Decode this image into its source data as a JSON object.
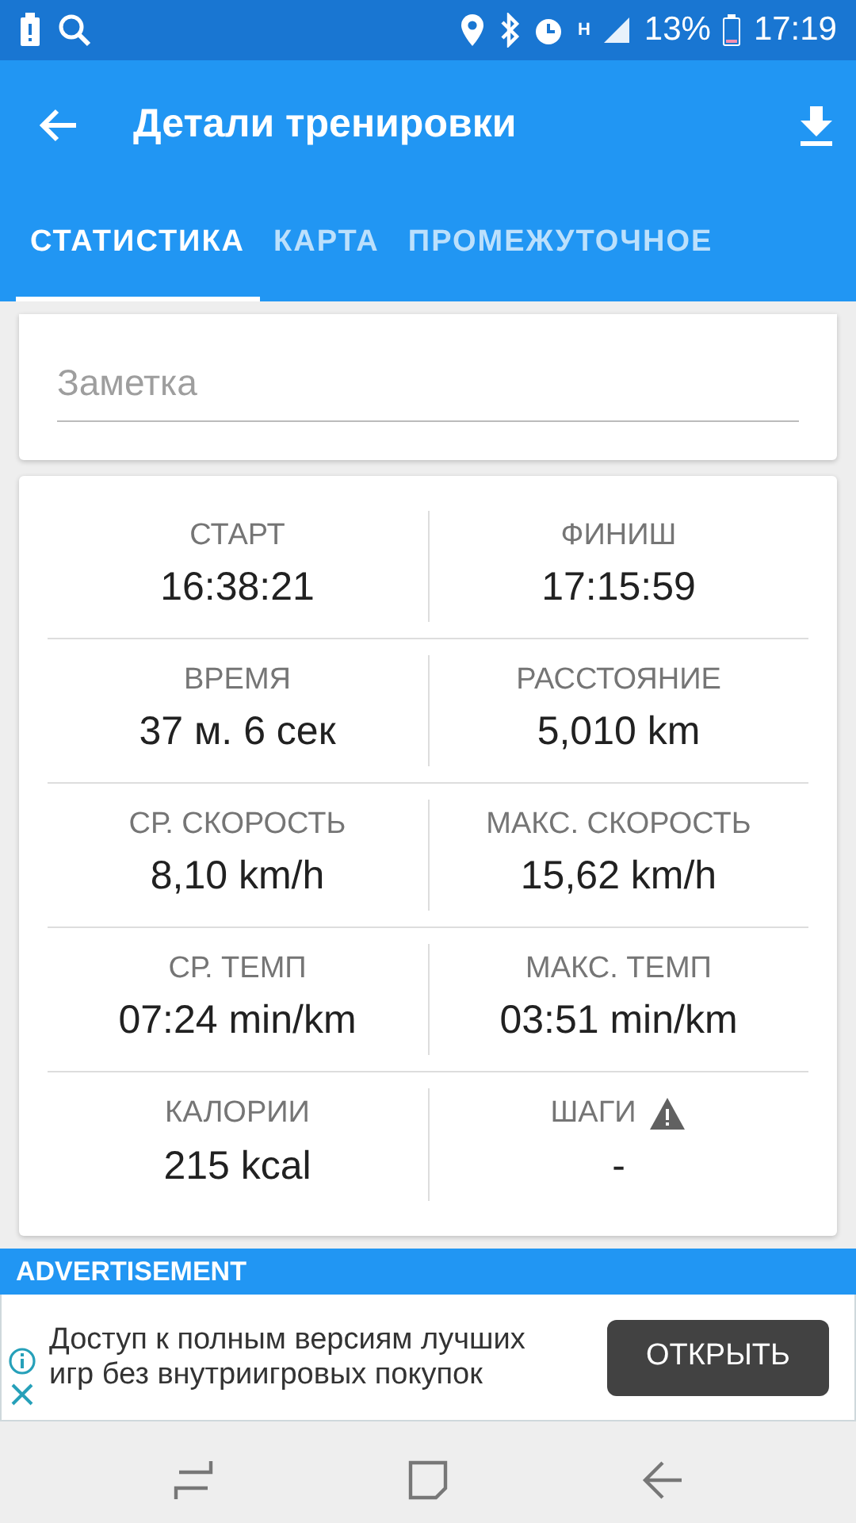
{
  "status_bar": {
    "network": "H",
    "battery": "13%",
    "time": "17:19"
  },
  "app_bar": {
    "title": "Детали тренировки"
  },
  "tabs": [
    {
      "label": "СТАТИСТИКА",
      "selected": true
    },
    {
      "label": "КАРТА",
      "selected": false
    },
    {
      "label": "ПРОМЕЖУТОЧНОЕ",
      "selected": false
    }
  ],
  "note": {
    "placeholder": "Заметка"
  },
  "stats": [
    [
      {
        "label": "СТАРТ",
        "value": "16:38:21"
      },
      {
        "label": "ФИНИШ",
        "value": "17:15:59"
      }
    ],
    [
      {
        "label": "ВРЕМЯ",
        "value": "37 м. 6 сек"
      },
      {
        "label": "РАССТОЯНИЕ",
        "value": "5,010 km"
      }
    ],
    [
      {
        "label": "СР. СКОРОСТЬ",
        "value": "8,10 km/h"
      },
      {
        "label": "МАКС. СКОРОСТЬ",
        "value": "15,62 km/h"
      }
    ],
    [
      {
        "label": "СР. ТЕМП",
        "value": "07:24 min/km"
      },
      {
        "label": "МАКС. ТЕМП",
        "value": "03:51 min/km"
      }
    ],
    [
      {
        "label": "КАЛОРИИ",
        "value": "215 kcal"
      },
      {
        "label": "ШАГИ",
        "value": "-",
        "warning": true
      }
    ]
  ],
  "ad": {
    "header": "ADVERTISEMENT",
    "text": "Доступ к полным версиям лучших игр без внутриигровых покупок",
    "button": "ОТКРЫТЬ"
  }
}
